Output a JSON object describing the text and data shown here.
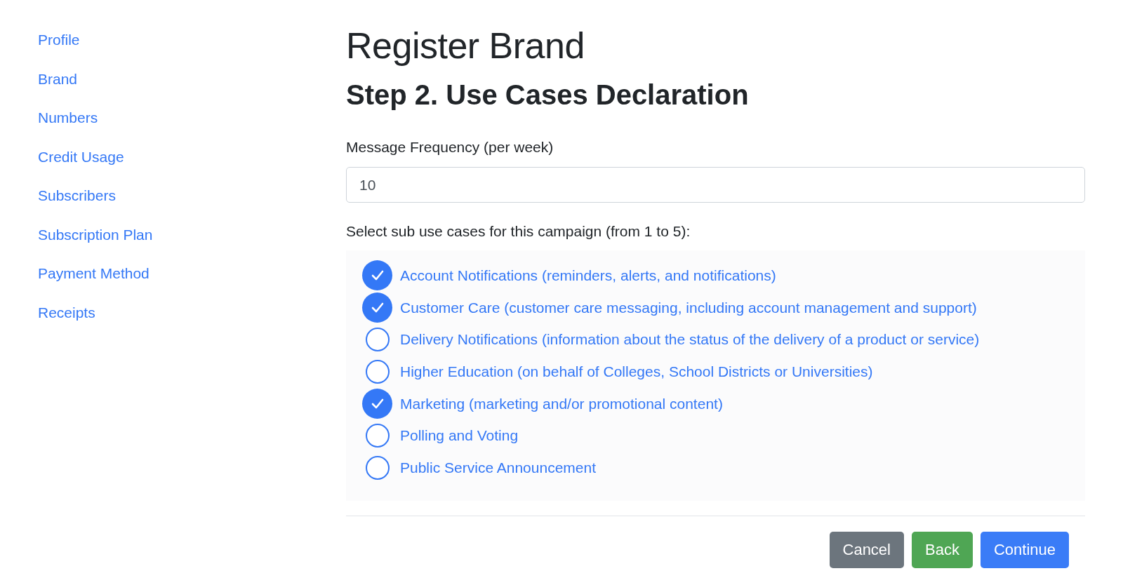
{
  "sidebar": {
    "items": [
      {
        "label": "Profile"
      },
      {
        "label": "Brand"
      },
      {
        "label": "Numbers"
      },
      {
        "label": "Credit Usage"
      },
      {
        "label": "Subscribers"
      },
      {
        "label": "Subscription Plan"
      },
      {
        "label": "Payment Method"
      },
      {
        "label": "Receipts"
      }
    ]
  },
  "page": {
    "title": "Register Brand",
    "step_title": "Step 2. Use Cases Declaration"
  },
  "frequency_field": {
    "label": "Message Frequency (per week)",
    "value": "10"
  },
  "use_cases": {
    "prompt": "Select sub use cases for this campaign (from 1 to 5):",
    "options": [
      {
        "label": "Account Notifications (reminders, alerts, and notifications)",
        "checked": true
      },
      {
        "label": "Customer Care (customer care messaging, including account management and support)",
        "checked": true
      },
      {
        "label": "Delivery Notifications (information about the status of the delivery of a product or service)",
        "checked": false
      },
      {
        "label": "Higher Education (on behalf of Colleges, School Districts or Universities)",
        "checked": false
      },
      {
        "label": "Marketing (marketing and/or promotional content)",
        "checked": true
      },
      {
        "label": "Polling and Voting",
        "checked": false
      },
      {
        "label": "Public Service Announcement",
        "checked": false
      }
    ]
  },
  "buttons": [
    {
      "label": "Cancel",
      "kind": "secondary"
    },
    {
      "label": "Back",
      "kind": "success"
    },
    {
      "label": "Continue",
      "kind": "primary"
    }
  ]
}
